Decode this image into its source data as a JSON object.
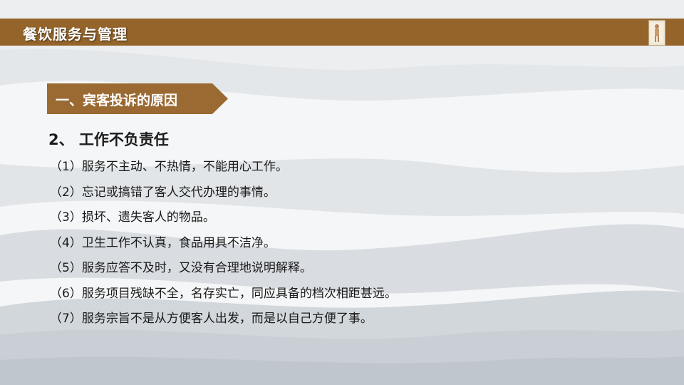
{
  "header": {
    "title": "餐饮服务与管理",
    "bar_color": "#94642a"
  },
  "section": {
    "tag_label": "一、宾客投诉的原因",
    "tag_color": "#9a6a32"
  },
  "subheading": "2、 工作不负责任",
  "items": [
    "（1）服务不主动、不热情，不能用心工作。",
    "（2）忘记或搞错了客人交代办理的事情。",
    "（3）损坏、遗失客人的物品。",
    "（4）卫生工作不认真，食品用具不洁净。",
    "（5）服务应答不及时，又没有合理地说明解释。",
    "（6）服务项目残缺不全，名存实亡，同应具备的档次相距甚远。",
    "（7）服务宗旨不是从方便客人出发，而是以自己方便了事。"
  ],
  "icons": {
    "logo": "figure-logo-icon"
  }
}
